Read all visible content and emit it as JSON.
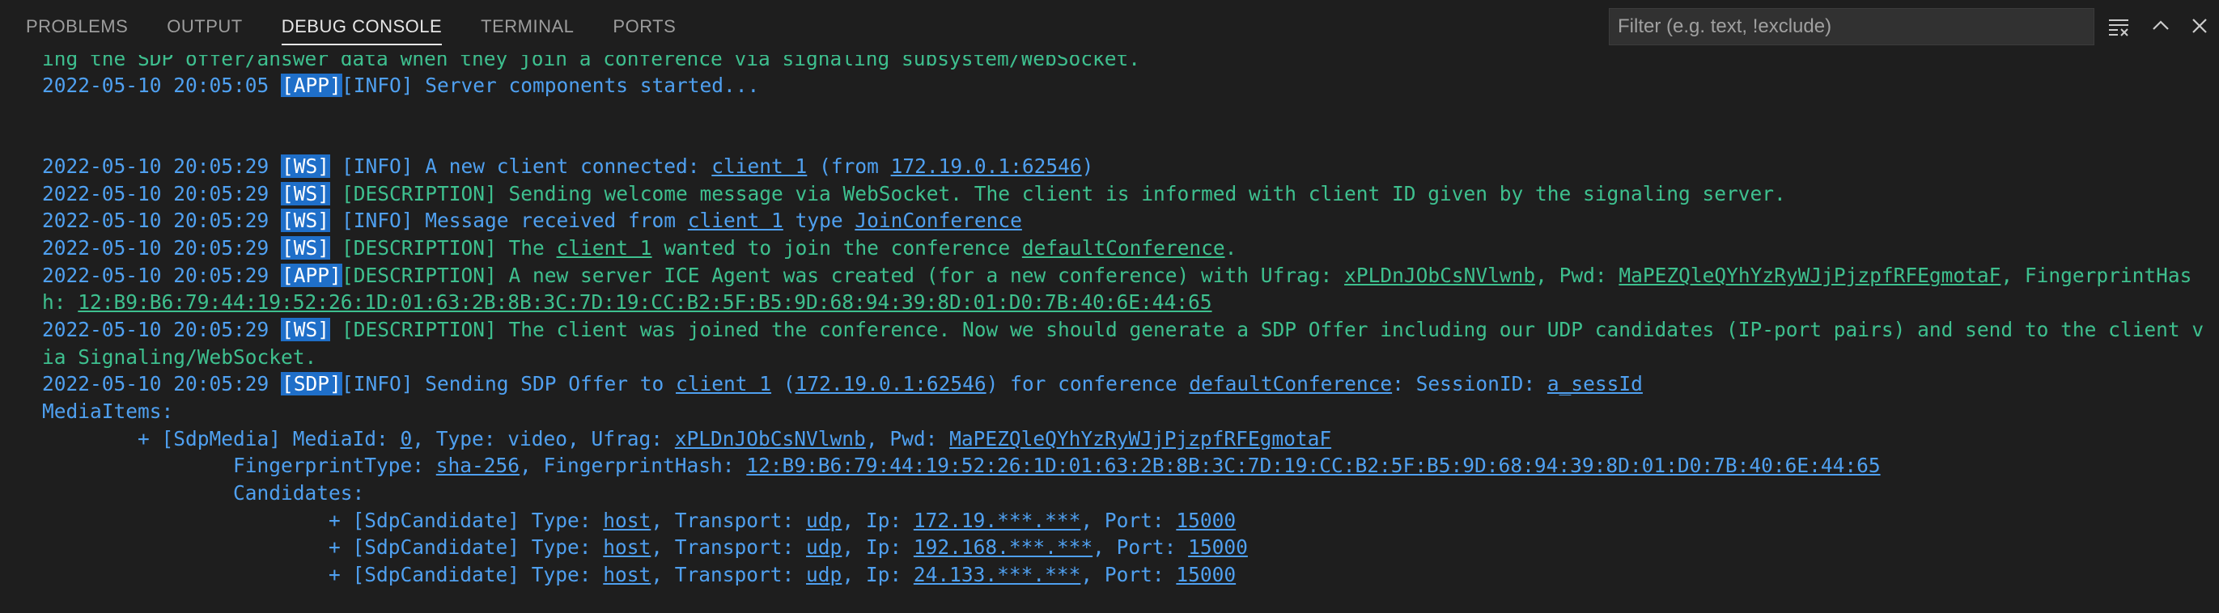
{
  "tabs": [
    {
      "label": "PROBLEMS",
      "active": false
    },
    {
      "label": "OUTPUT",
      "active": false
    },
    {
      "label": "DEBUG CONSOLE",
      "active": true
    },
    {
      "label": "TERMINAL",
      "active": false
    },
    {
      "label": "PORTS",
      "active": false
    }
  ],
  "filter": {
    "placeholder": "Filter (e.g. text, !exclude)"
  },
  "toolbar": {
    "clear_icon": "clear-all-icon",
    "maximize_icon": "chevron-up-icon",
    "close_icon": "close-icon"
  },
  "colors": {
    "background": "#1e1e1e",
    "info_blue": "#4fa0f0",
    "desc_green": "#3ec08f",
    "tag_bg": "#1f6fc9"
  },
  "log": {
    "l0": "ing the SDP offer/answer data when they join a conference via signaling subsystem/WebSocket.",
    "l1": {
      "ts": "2022-05-10 20:05:05",
      "tag": "[APP]",
      "msg": "[INFO] Server components started..."
    },
    "l2": {
      "ts": "2022-05-10 20:05:29",
      "tag": "[WS]",
      "pre": "[INFO] A new client connected: ",
      "client": "client 1",
      "mid": " (from ",
      "addr": "172.19.0.1:62546",
      "post": ")"
    },
    "l3": {
      "ts": "2022-05-10 20:05:29",
      "tag": "[WS]",
      "msg": "[DESCRIPTION] Sending welcome message via WebSocket. The client is informed with client ID given by the signaling server."
    },
    "l4": {
      "ts": "2022-05-10 20:05:29",
      "tag": "[WS]",
      "pre": "[INFO] Message received from ",
      "client": "client 1",
      "mid": " type ",
      "type": "JoinConference"
    },
    "l5": {
      "ts": "2022-05-10 20:05:29",
      "tag": "[WS]",
      "pre": "[DESCRIPTION] The ",
      "client": "client 1",
      "mid": " wanted to join the conference ",
      "conf": "defaultConference",
      "post": "."
    },
    "l6": {
      "ts": "2022-05-10 20:05:29",
      "tag": "[APP]",
      "pre": "[DESCRIPTION] A new server ICE Agent was created (for a new conference) with Ufrag: ",
      "ufrag": "xPLDnJObCsNVlwnb",
      "mid": ", Pwd: ",
      "pwd": "MaPEZQleQYhYzRyWJjPjzpfRFEgmotaF",
      "post": ", FingerprintHas"
    },
    "l7": {
      "pre": "h: ",
      "fp": "12:B9:B6:79:44:19:52:26:1D:01:63:2B:8B:3C:7D:19:CC:B2:5F:B5:9D:68:94:39:8D:01:D0:7B:40:6E:44:65"
    },
    "l8": {
      "ts": "2022-05-10 20:05:29",
      "tag": "[WS]",
      "msg": "[DESCRIPTION] The client was joined the conference. Now we should generate a SDP Offer including our UDP candidates (IP-port pairs) and send to the client v"
    },
    "l9": "ia Signaling/WebSocket.",
    "l10": {
      "ts": "2022-05-10 20:05:29",
      "tag": "[SDP]",
      "pre": "[INFO] Sending SDP Offer to ",
      "client": "client 1",
      "mid": " (",
      "addr": "172.19.0.1:62546",
      "mid2": ") for conference ",
      "conf": "defaultConference",
      "mid3": ": SessionID: ",
      "sess": "a_sessId"
    },
    "l11": "MediaItems:",
    "l12": {
      "pre": "        + [SdpMedia] MediaId: ",
      "mediaId": "0",
      "mid": ", Type: video, Ufrag: ",
      "ufrag": "xPLDnJObCsNVlwnb",
      "mid2": ", Pwd: ",
      "pwd": "MaPEZQleQYhYzRyWJjPjzpfRFEgmotaF"
    },
    "l13": {
      "pre": "                FingerprintType: ",
      "fptype": "sha-256",
      "mid": ", FingerprintHash: ",
      "fp": "12:B9:B6:79:44:19:52:26:1D:01:63:2B:8B:3C:7D:19:CC:B2:5F:B5:9D:68:94:39:8D:01:D0:7B:40:6E:44:65"
    },
    "l14": "                Candidates:",
    "candidates": [
      {
        "pre": "                        + [SdpCandidate] Type: ",
        "type": "host",
        "mid": ", Transport: ",
        "transport": "udp",
        "mid2": ", Ip: ",
        "ip": "172.19.***.***",
        "mid3": ", Port: ",
        "port": "15000"
      },
      {
        "pre": "                        + [SdpCandidate] Type: ",
        "type": "host",
        "mid": ", Transport: ",
        "transport": "udp",
        "mid2": ", Ip: ",
        "ip": "192.168.***.***",
        "mid3": ", Port: ",
        "port": "15000"
      },
      {
        "pre": "                        + [SdpCandidate] Type: ",
        "type": "host",
        "mid": ", Transport: ",
        "transport": "udp",
        "mid2": ", Ip: ",
        "ip": "24.133.***.***",
        "mid3": ", Port: ",
        "port": "15000"
      }
    ]
  }
}
